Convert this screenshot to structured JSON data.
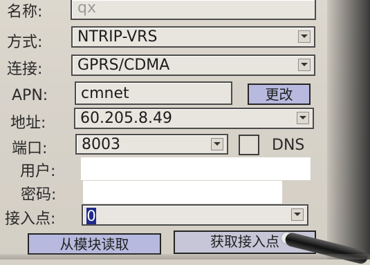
{
  "form": {
    "name_label": "名称:",
    "name_value": "qx",
    "mode_label": "方式:",
    "mode_value": "NTRIP-VRS",
    "connection_label": "连接:",
    "connection_value": "GPRS/CDMA",
    "apn_label": "APN:",
    "apn_value": "cmnet",
    "change_button": "更改",
    "address_label": "地址:",
    "address_value": "60.205.8.49",
    "port_label": "端口:",
    "port_value": "8003",
    "dns_label": "DNS",
    "user_label": "用户:",
    "password_label": "密码:",
    "mountpoint_label": "接入点:",
    "mountpoint_value": "0"
  },
  "buttons": {
    "read_from_module": "从模块读取",
    "get_mountpoint": "获取接入点"
  },
  "icons": {
    "dropdown": "chevron-down-icon"
  },
  "colors": {
    "background": "#d7d2c8",
    "button_fill": "#b7b9de",
    "selection": "#1f2a8a"
  }
}
